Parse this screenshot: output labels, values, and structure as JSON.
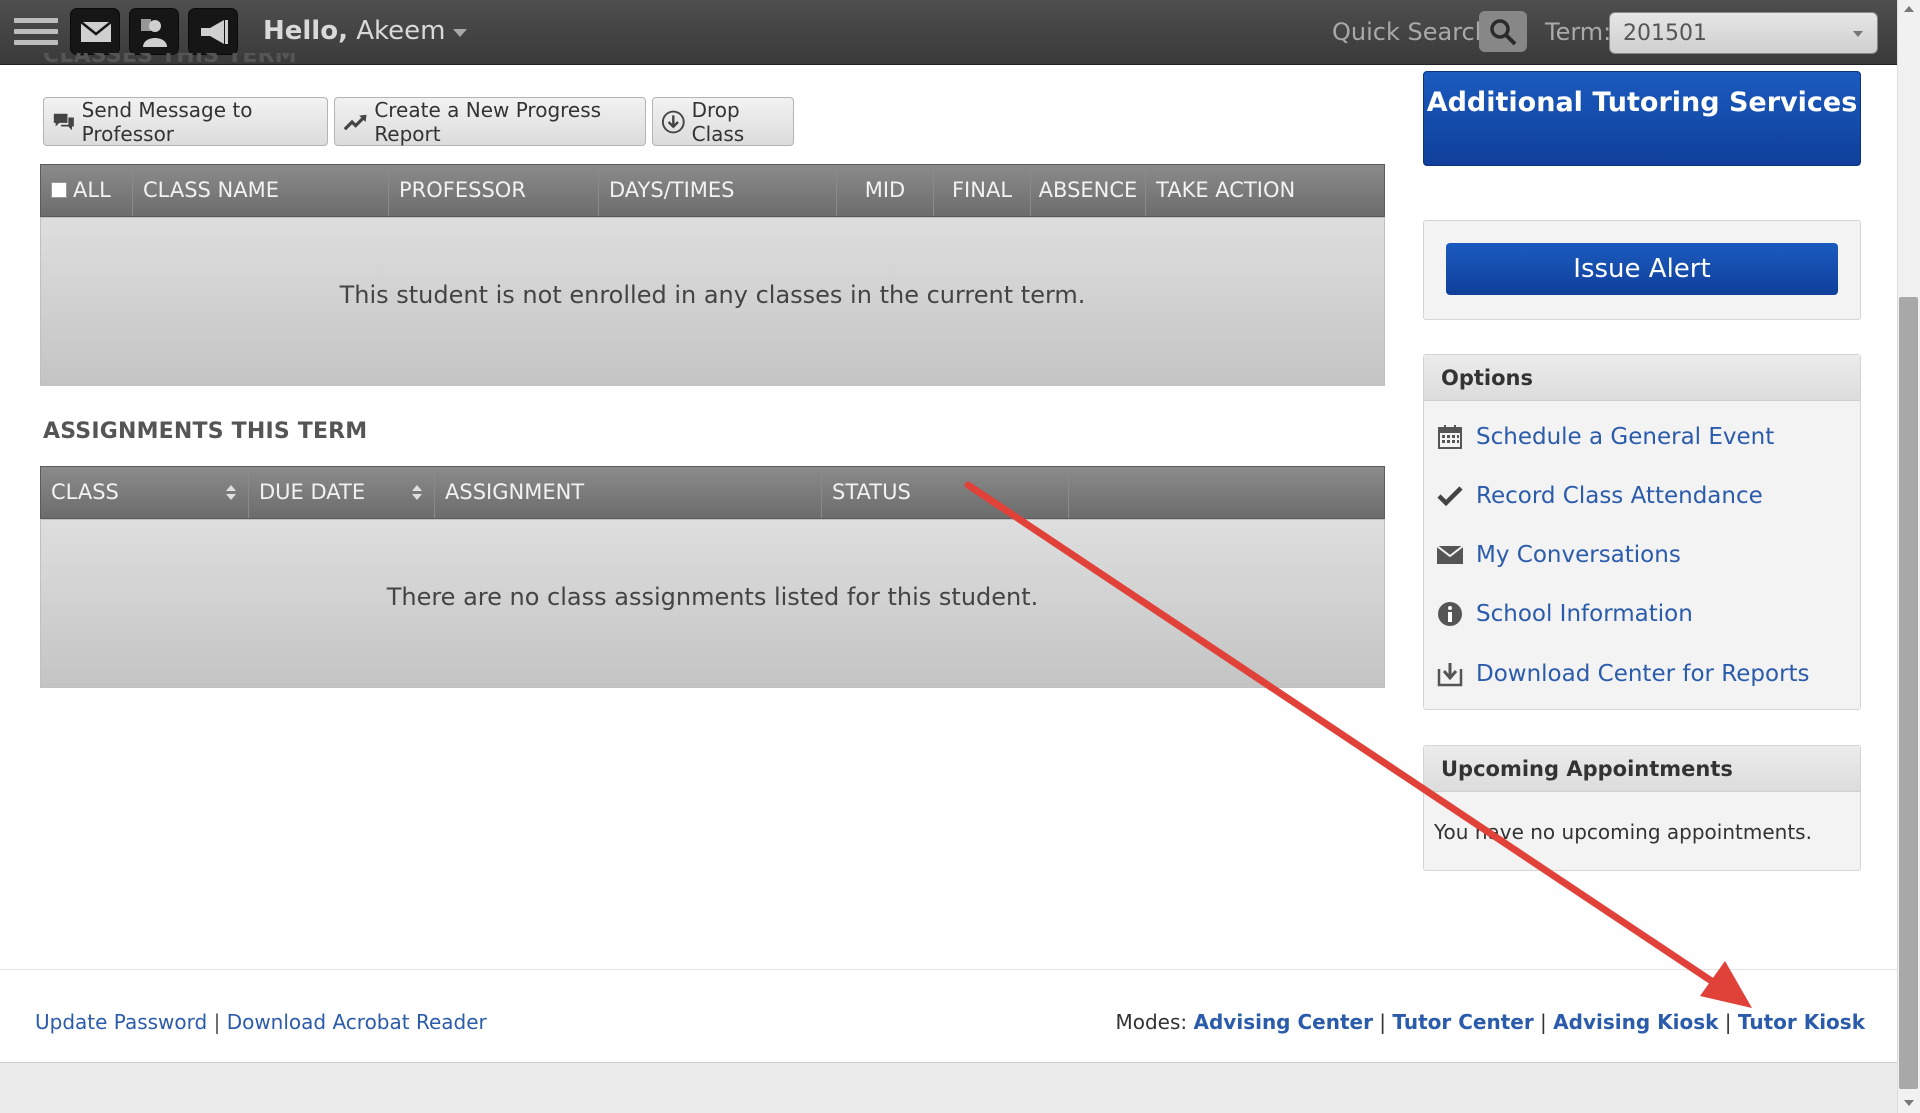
{
  "topbar": {
    "greeting": "Hello,",
    "user_name": "Akeem",
    "quick_search_label": "Quick Search:",
    "term_label": "Term:",
    "term_value": "201501"
  },
  "classes": {
    "section_title": "CLASSES THIS TERM",
    "buttons": {
      "send_message": "Send Message to Professor",
      "progress_report": "Create a New Progress Report",
      "drop_class": "Drop Class"
    },
    "columns": [
      "ALL",
      "CLASS NAME",
      "PROFESSOR",
      "DAYS/TIMES",
      "MID",
      "FINAL",
      "ABSENCE",
      "TAKE ACTION"
    ],
    "empty_message": "This student is not enrolled in any classes in the current term."
  },
  "assignments": {
    "section_title": "ASSIGNMENTS THIS TERM",
    "columns": [
      "CLASS",
      "DUE DATE",
      "ASSIGNMENT",
      "STATUS",
      ""
    ],
    "empty_message": "There are no class assignments listed for this student."
  },
  "sidebar": {
    "tutoring_button": "Additional Tutoring Services",
    "issue_alert": "Issue Alert",
    "options_title": "Options",
    "options": [
      {
        "label": "Schedule a General Event",
        "icon": "calendar-icon"
      },
      {
        "label": "Record Class Attendance",
        "icon": "checkmark-icon"
      },
      {
        "label": "My Conversations",
        "icon": "envelope-icon"
      },
      {
        "label": "School Information",
        "icon": "info-icon"
      },
      {
        "label": "Download Center for Reports",
        "icon": "download-icon"
      }
    ],
    "appointments_title": "Upcoming Appointments",
    "appointments_empty": "You have no upcoming appointments."
  },
  "footer": {
    "update_password": "Update Password",
    "download_acrobat": "Download Acrobat Reader",
    "modes_label": "Modes:",
    "modes": [
      "Advising Center",
      "Tutor Center",
      "Advising Kiosk",
      "Tutor Kiosk"
    ],
    "separator": "|"
  },
  "colors": {
    "accent_blue": "#1b5bbf",
    "link_blue": "#2b5bab",
    "topbar": "#444444",
    "annotation_arrow": "#e0423a"
  }
}
